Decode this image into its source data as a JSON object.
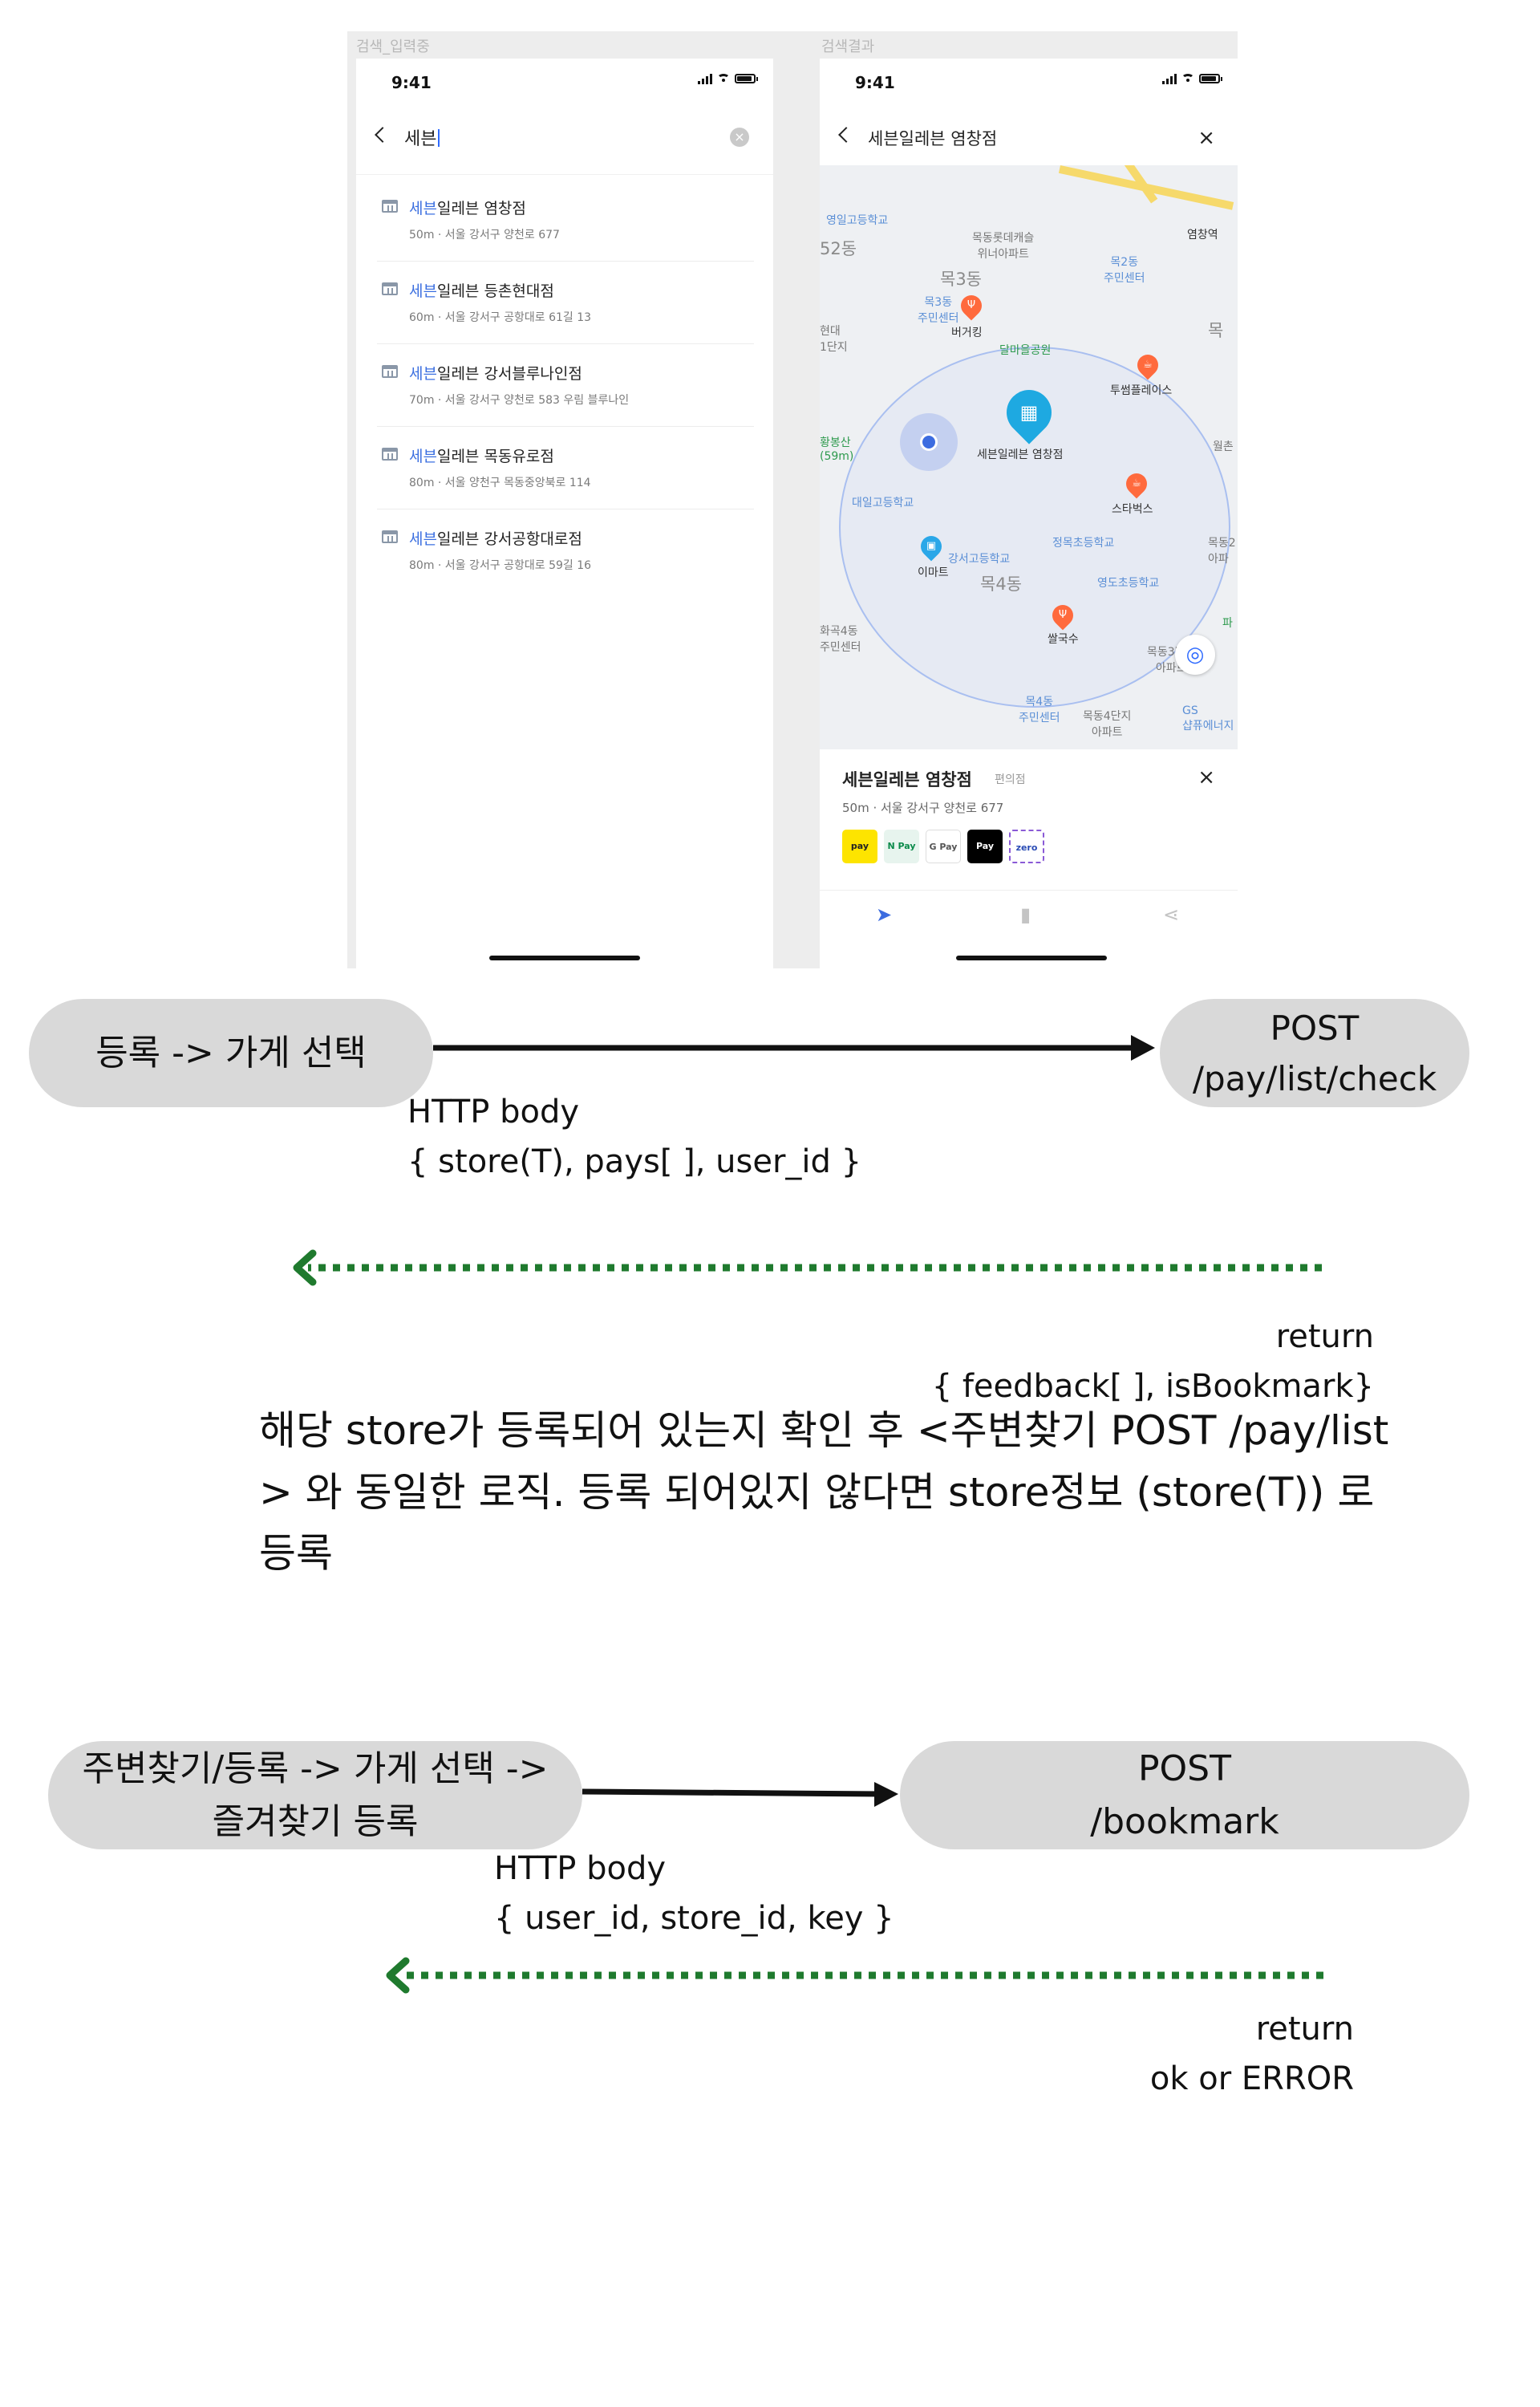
{
  "mockup": {
    "screen1_label": "검색_입력중",
    "screen2_label": "검색결과",
    "status_time": "9:41",
    "search_query": "세븐",
    "results": [
      {
        "highlight": "세븐",
        "rest": "일레븐 염창점",
        "sub": "50m · 서울 강서구 양천로 677"
      },
      {
        "highlight": "세븐",
        "rest": "일레븐 등촌현대점",
        "sub": "60m · 서울 강서구 공항대로 61길 13"
      },
      {
        "highlight": "세븐",
        "rest": "일레븐 강서블루나인점",
        "sub": "70m · 서울 강서구 양천로 583 우림 블루나인"
      },
      {
        "highlight": "세븐",
        "rest": "일레븐 목동유로점",
        "sub": "80m · 서울 양천구 목동중앙북로 114"
      },
      {
        "highlight": "세븐",
        "rest": "일레븐 강서공항대로점",
        "sub": "80m · 서울 강서구 공항대로 59길 16"
      }
    ],
    "result_title": "세븐일레븐 염창점",
    "map_labels": {
      "l1": "영일고등학교",
      "l2": "목동롯데캐슬\n위너아파트",
      "l3": "목2동\n주민센터",
      "l4": "염창역",
      "l5": "목3동",
      "l6": "목3동\n주민센터",
      "l7": "버거킹",
      "l8": "달마을공원",
      "l9": "투썸플레이스",
      "l10": "세븐일레븐 염창점",
      "l11": "스타벅스",
      "l12": "대일고등학교",
      "l13": "정목초등학교",
      "l14": "강서고등학교",
      "l15": "이마트",
      "l16": "목4동",
      "l17": "영도초등학교",
      "l18": "쌀국수",
      "l19": "화곡4동\n주민센터",
      "l20": "목동3단지\n아파트",
      "l21": "목4동\n주민센터",
      "l22": "목동4단지\n아파트",
      "l23": "GS\n샵퓨에너지",
      "l24": "52동",
      "l25": "목",
      "l26": "목동2\n아파",
      "l27": "황봉산\n(59m)",
      "l28": "현대\n1단지",
      "l29": "월촌",
      "l30": "파"
    },
    "sheet": {
      "name": "세븐일레븐 염창점",
      "category": "편의점",
      "address": "50m · 서울 강서구 양천로 677",
      "pays": [
        "pay",
        "N Pay",
        "G Pay",
        "Pay",
        "zero"
      ]
    }
  },
  "flow1": {
    "source": "등록 -> 가게 선택",
    "target": "POST\n/pay/list/check",
    "request": "HTTP body\n{ store(T), pays[ ], user_id }",
    "response": "return\n{ feedback[ ], isBookmark}"
  },
  "description": "해당 store가 등록되어 있는지 확인 후 <주변찾기 POST /pay/list > 와 동일한 로직. 등록 되어있지 않다면 store정보 (store(T)) 로 등록",
  "flow2": {
    "source": "주변찾기/등록 -> 가게 선택 ->\n즐겨찾기 등록",
    "target": "POST\n/bookmark",
    "request": "HTTP body\n{ user_id, store_id, key }",
    "response": "return\nok or ERROR"
  },
  "colors": {
    "request_arrow": "#111111",
    "response_arrow": "#1f7a2e",
    "pill_fill": "#d9d9d9",
    "highlight": "#3b6fe0"
  }
}
